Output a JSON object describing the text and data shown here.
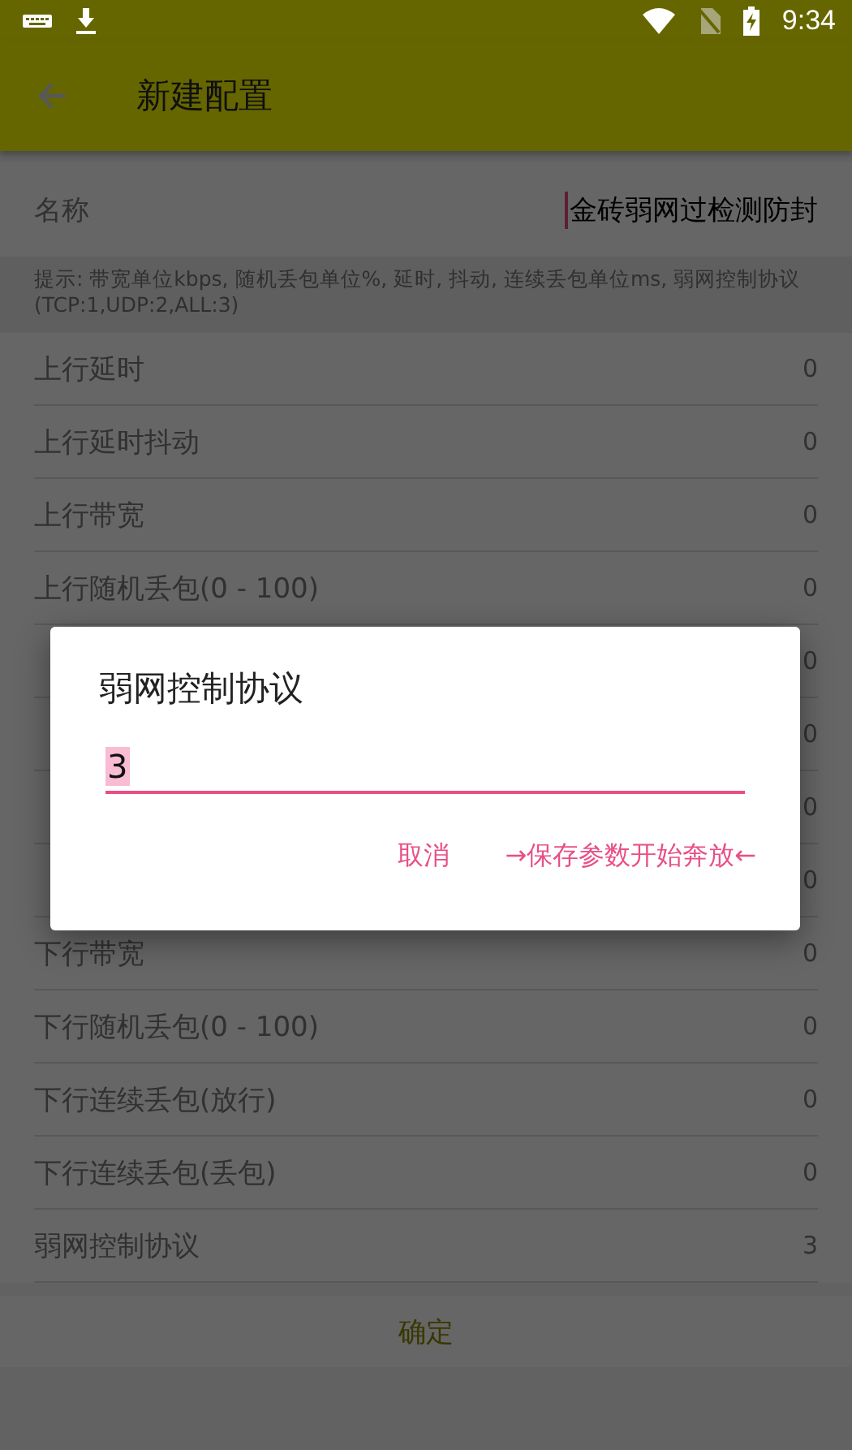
{
  "status_bar": {
    "time": "9:34"
  },
  "toolbar": {
    "title": "新建配置"
  },
  "name_field": {
    "label": "名称",
    "value": "金砖弱网过检测防封"
  },
  "hint": "提示: 带宽单位kbps, 随机丢包单位%, 延时, 抖动, 连续丢包单位ms, 弱网控制协议(TCP:1,UDP:2,ALL:3)",
  "rows": [
    {
      "label": "上行延时",
      "value": "0"
    },
    {
      "label": "上行延时抖动",
      "value": "0"
    },
    {
      "label": "上行带宽",
      "value": "0"
    },
    {
      "label": "上行随机丢包(0 - 100)",
      "value": "0"
    },
    {
      "value": "0"
    },
    {
      "value": "0"
    },
    {
      "value": "0"
    },
    {
      "value": "0"
    },
    {
      "label": "下行带宽",
      "value": "0"
    },
    {
      "label": "下行随机丢包(0 - 100)",
      "value": "0"
    },
    {
      "label": "下行连续丢包(放行)",
      "value": "0"
    },
    {
      "label": "下行连续丢包(丢包)",
      "value": "0"
    },
    {
      "label": "弱网控制协议",
      "value": "3"
    }
  ],
  "confirm_button": "确定",
  "dialog": {
    "title": "弱网控制协议",
    "value": "3",
    "buttons": [
      "取消",
      "→保存参数开始奔放←"
    ]
  }
}
